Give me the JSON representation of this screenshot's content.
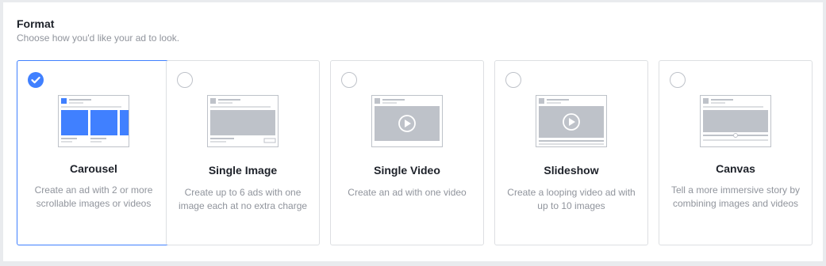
{
  "header": {
    "title": "Format",
    "subtitle": "Choose how you'd like your ad to look."
  },
  "colors": {
    "accent": "#4080ff",
    "border": "#dddfe2",
    "muted_text": "#90949c",
    "thumb_gray": "#bec2c9"
  },
  "formats": [
    {
      "name": "Carousel",
      "description": "Create an ad with 2 or more scrollable images or videos",
      "selected": true,
      "icon": "carousel-preview-icon"
    },
    {
      "name": "Single Image",
      "description": "Create up to 6 ads with one image each at no extra charge",
      "selected": false,
      "icon": "single-image-preview-icon"
    },
    {
      "name": "Single Video",
      "description": "Create an ad with one video",
      "selected": false,
      "icon": "single-video-preview-icon"
    },
    {
      "name": "Slideshow",
      "description": "Create a looping video ad with up to 10 images",
      "selected": false,
      "icon": "slideshow-preview-icon"
    },
    {
      "name": "Canvas",
      "description": "Tell a more immersive story by combining images and videos",
      "selected": false,
      "icon": "canvas-preview-icon"
    }
  ]
}
